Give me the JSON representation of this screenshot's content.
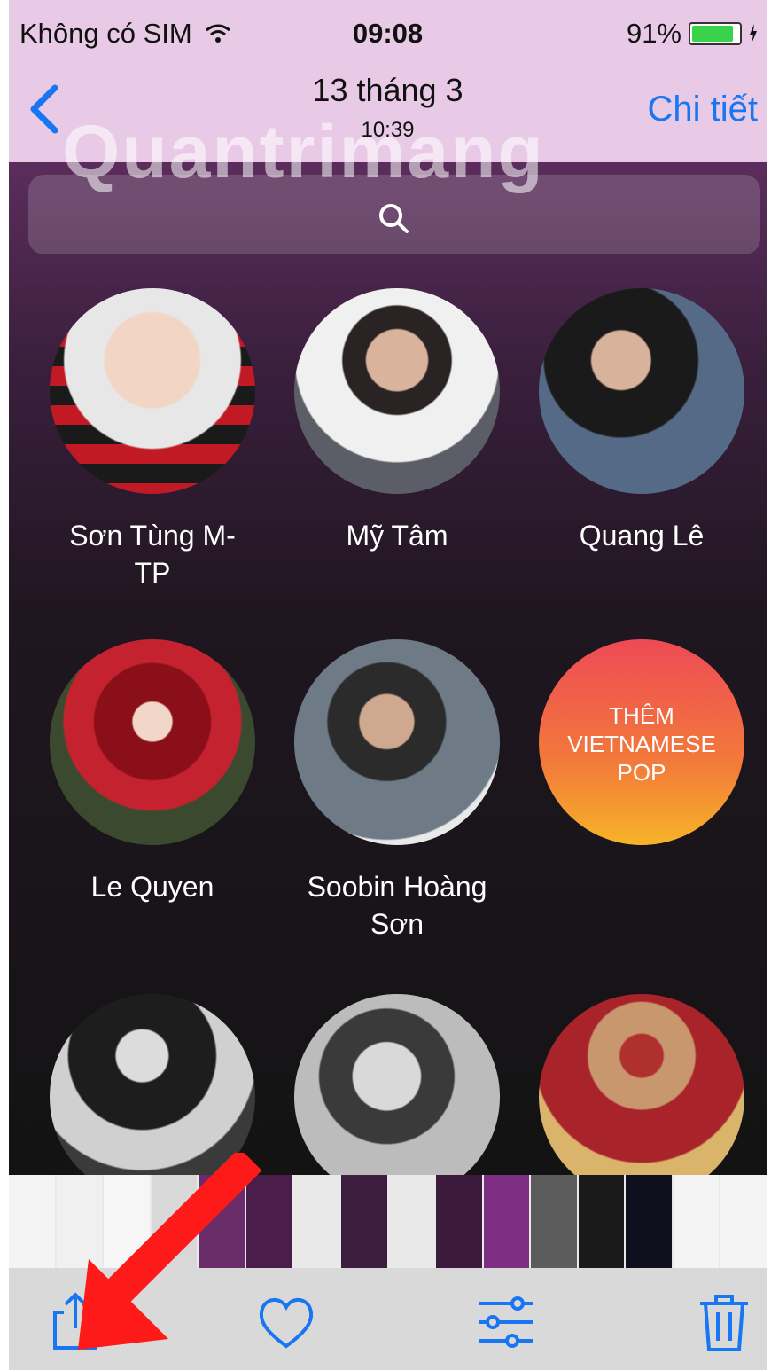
{
  "status_bar": {
    "carrier": "Không có SIM",
    "time": "09:08",
    "battery_text": "91%",
    "battery_level": 0.91
  },
  "nav": {
    "title": "13 tháng 3",
    "subtitle": "10:39",
    "detail": "Chi tiết"
  },
  "watermark": "Quantrimang",
  "artists": [
    {
      "name": "Sơn Tùng M-\nTP"
    },
    {
      "name": "Mỹ Tâm"
    },
    {
      "name": "Quang Lê"
    },
    {
      "name": "Le Quyen"
    },
    {
      "name": "Soobin Hoàng\nSơn"
    },
    {
      "name": ""
    },
    {
      "name": ""
    },
    {
      "name": ""
    },
    {
      "name": ""
    }
  ],
  "add_tile": {
    "line1": "THÊM",
    "line2": "VIETNAMESE",
    "line3": "POP"
  },
  "colors": {
    "accent": "#1876f2",
    "bar_bg": "#e8c9e6",
    "arrow": "#ff1a1a"
  }
}
